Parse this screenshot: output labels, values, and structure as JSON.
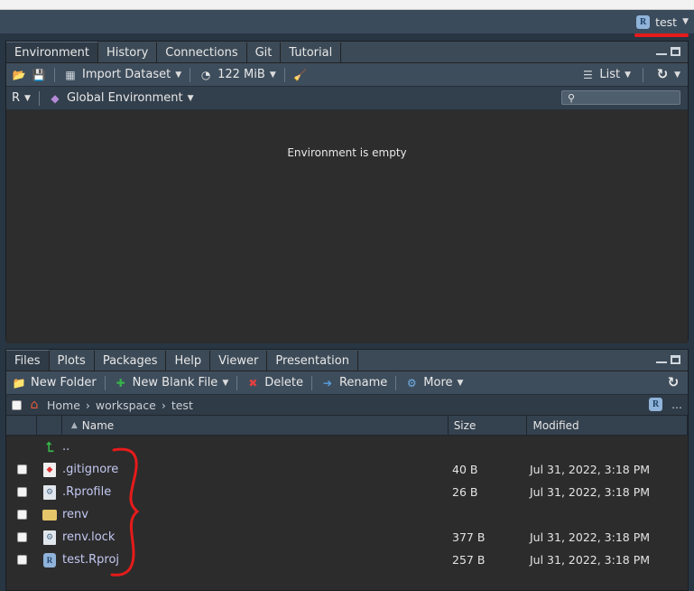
{
  "project": {
    "name": "test"
  },
  "env_pane": {
    "tabs": [
      "Environment",
      "History",
      "Connections",
      "Git",
      "Tutorial"
    ],
    "active_tab": 0,
    "toolbar": {
      "import_dataset": "Import Dataset",
      "memory": "122 MiB",
      "list_view": "List"
    },
    "subbar": {
      "language": "R",
      "environment": "Global Environment",
      "search_placeholder": ""
    },
    "empty_message": "Environment is empty"
  },
  "files_pane": {
    "tabs": [
      "Files",
      "Plots",
      "Packages",
      "Help",
      "Viewer",
      "Presentation"
    ],
    "active_tab": 0,
    "toolbar": {
      "new_folder": "New Folder",
      "new_blank_file": "New Blank File",
      "delete": "Delete",
      "rename": "Rename",
      "more": "More"
    },
    "breadcrumb": [
      "Home",
      "workspace",
      "test"
    ],
    "breadcrumb_more": "...",
    "columns": {
      "name": "Name",
      "size": "Size",
      "modified": "Modified"
    },
    "parent_dir": "..",
    "files": [
      {
        "name": ".gitignore",
        "size": "40 B",
        "modified": "Jul 31, 2022, 3:18 PM",
        "icon": "gitignore-file-icon"
      },
      {
        "name": ".Rprofile",
        "size": "26 B",
        "modified": "Jul 31, 2022, 3:18 PM",
        "icon": "config-file-icon"
      },
      {
        "name": "renv",
        "size": "",
        "modified": "",
        "icon": "folder-icon"
      },
      {
        "name": "renv.lock",
        "size": "377 B",
        "modified": "Jul 31, 2022, 3:18 PM",
        "icon": "config-file-icon"
      },
      {
        "name": "test.Rproj",
        "size": "257 B",
        "modified": "Jul 31, 2022, 3:18 PM",
        "icon": "rproj-file-icon"
      }
    ]
  },
  "colors": {
    "annotation": "#e61b1b",
    "link": "#c3c9f2",
    "toolbar": "#3e4d5c"
  }
}
